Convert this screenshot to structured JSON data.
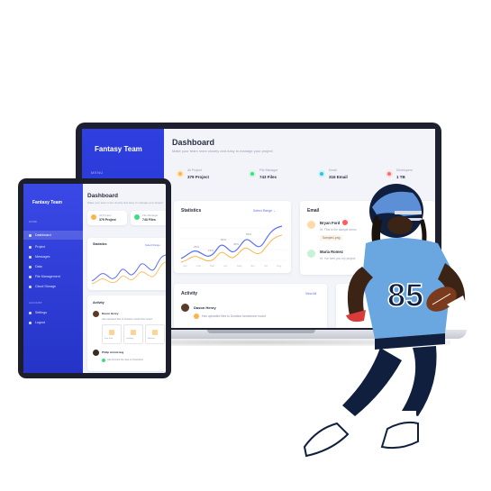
{
  "laptop": {
    "brand": "Fantasy Team",
    "menu_label": "MENU",
    "dashboard": {
      "title": "Dashboard",
      "subtitle": "Make your team more closely and easy to manage your project"
    },
    "stats": [
      {
        "label": "All Project",
        "value": "379 Project",
        "color": "#ffb347"
      },
      {
        "label": "File Manager",
        "value": "743 Files",
        "color": "#3ddc84"
      },
      {
        "label": "Email",
        "value": "316 Email",
        "color": "#29c4e0"
      },
      {
        "label": "Developers",
        "value": "1 TB",
        "color": "#ff6b6b"
      }
    ],
    "statistics": {
      "title": "Statistics",
      "range": "Select Range ⌄",
      "months": [
        "Jan",
        "Feb",
        "Mar",
        "Apr",
        "May",
        "Jun",
        "Jul",
        "Aug"
      ],
      "data_labels": [
        "25%",
        "15%",
        "60%",
        "45%",
        "55%"
      ]
    },
    "email": {
      "title": "Email",
      "items": [
        {
          "name": "Bryan Ford",
          "preview": "Hi. This is the sample demo",
          "attachment": "Sample1.png"
        },
        {
          "name": "Maria Romez",
          "preview": "Hi. I've sent you my project"
        }
      ]
    },
    "activity": {
      "title": "Activity",
      "view_all": "View All",
      "person": "Dason Henry",
      "text": "Has uploaded files to Duration randomizer board"
    }
  },
  "tablet": {
    "brand": "Fantasy Team",
    "home_label": "HOME",
    "nav": [
      "Dashboard",
      "Project",
      "Messages",
      "Data",
      "File Management",
      "Cloud Storage"
    ],
    "account_label": "ACCOUNT",
    "account_nav": [
      "Settings",
      "Logout"
    ],
    "dashboard": {
      "title": "Dashboard",
      "subtitle": "Make your team more closely and easy to manage your project"
    },
    "stats": [
      {
        "label": "All Project",
        "value": "379 Project",
        "color": "#ffb347"
      },
      {
        "label": "File Manager",
        "value": "743 Files",
        "color": "#3ddc84"
      }
    ],
    "statistics": {
      "title": "Statistics",
      "range": "Select Range"
    },
    "activity": {
      "title": "Activity",
      "entries": [
        {
          "person": "Dason Henry",
          "text": "Has uploaded files to Duration randomizer board",
          "files": [
            "Icon Font",
            "Landing",
            "Mockup"
          ]
        },
        {
          "person": "Philip Armstrong",
          "text": "Has finished the task on Illustration"
        }
      ]
    }
  },
  "player": {
    "jersey_number": "85"
  }
}
